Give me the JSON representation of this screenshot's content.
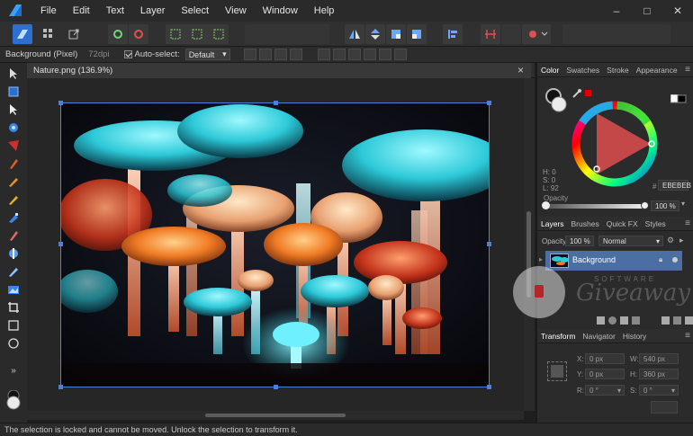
{
  "app": {
    "menu": [
      "File",
      "Edit",
      "Text",
      "Layer",
      "Select",
      "View",
      "Window",
      "Help"
    ],
    "window_controls": [
      "–",
      "□",
      "✕"
    ]
  },
  "context_bar": {
    "selection_label": "Background (Pixel)",
    "dpi": "72dpi",
    "auto_select_label": "Auto-select:",
    "auto_select_value": "Default"
  },
  "document": {
    "tab_title": "Nature.png (136.9%)",
    "close_glyph": "×"
  },
  "color_panel": {
    "tabs": [
      "Color",
      "Swatches",
      "Stroke",
      "Appearance"
    ],
    "h": "H: 0",
    "s": "S: 0",
    "l": "L: 92",
    "hex": "EBEBEB",
    "hash": "#",
    "opacity_label": "Opacity",
    "opacity_value": "100 %"
  },
  "layers_panel": {
    "tabs": [
      "Layers",
      "Brushes",
      "Quick FX",
      "Styles"
    ],
    "opacity_label": "Opacity:",
    "opacity_value": "100 %",
    "blend_mode": "Normal",
    "layer_name": "Background"
  },
  "transform_panel": {
    "tabs": [
      "Transform",
      "Navigator",
      "History"
    ],
    "x_label": "X:",
    "x_value": "0 px",
    "y_label": "Y:",
    "y_value": "0 px",
    "w_label": "W:",
    "w_value": "540 px",
    "h_label": "H:",
    "h_value": "360 px",
    "r_label": "R:",
    "r_value": "0 °",
    "s_label": "S:",
    "s_value": "0 °"
  },
  "status": {
    "message": "The selection is locked and cannot be moved. Unlock the selection to transform it."
  },
  "watermark": {
    "line1": "SOFTWARE",
    "line2": "Giveaway"
  },
  "colors": {
    "accent": "#4f7fd8",
    "layer_selected": "#4b6fa3",
    "logo": "#3aa0ff"
  }
}
